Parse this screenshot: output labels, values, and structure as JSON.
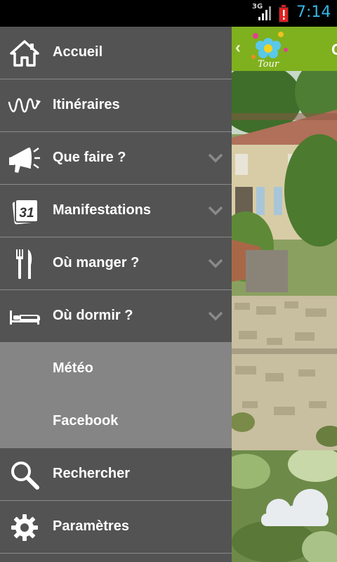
{
  "status_bar": {
    "network": "3G",
    "time": "7:14",
    "battery_color": "#e02020",
    "time_color": "#35b5e5"
  },
  "app_header": {
    "logo_text": "Tour",
    "title_partial": "C",
    "accent_color": "#7fb01e"
  },
  "drawer": {
    "items": [
      {
        "label": "Accueil",
        "icon": "home-icon",
        "expandable": false
      },
      {
        "label": "Itinéraires",
        "icon": "route-icon",
        "expandable": false
      },
      {
        "label": "Que faire ?",
        "icon": "megaphone-icon",
        "expandable": true
      },
      {
        "label": "Manifestations",
        "icon": "calendar-icon",
        "icon_text": "31",
        "expandable": true
      },
      {
        "label": "Où manger ?",
        "icon": "cutlery-icon",
        "expandable": true
      },
      {
        "label": "Où dormir ?",
        "icon": "bed-icon",
        "expandable": true
      },
      {
        "label": "Météo",
        "icon": "",
        "expandable": false
      },
      {
        "label": "Facebook",
        "icon": "",
        "expandable": false
      },
      {
        "label": "Rechercher",
        "icon": "search-icon",
        "expandable": false
      },
      {
        "label": "Paramètres",
        "icon": "gear-icon",
        "expandable": false
      }
    ]
  }
}
